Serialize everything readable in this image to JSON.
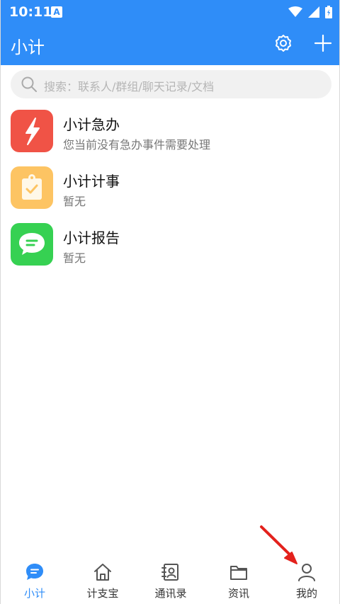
{
  "status_bar": {
    "time": "10:11",
    "a_badge": "A"
  },
  "header": {
    "title": "小计",
    "icons": [
      "gear-icon",
      "plus-icon"
    ]
  },
  "search": {
    "placeholder": "搜索：联系人/群组/聊天记录/文档"
  },
  "list": [
    {
      "title": "小计急办",
      "subtitle": "您当前没有急办事件需要处理",
      "icon": "lightning-icon",
      "color": "#f05346"
    },
    {
      "title": "小计计事",
      "subtitle": "暂无",
      "icon": "clipboard-icon",
      "color": "#fdc463"
    },
    {
      "title": "小计报告",
      "subtitle": "暂无",
      "icon": "chat-bubble-icon",
      "color": "#36d152"
    }
  ],
  "bottom_nav": [
    {
      "label": "小计",
      "icon": "chat-icon",
      "active": true
    },
    {
      "label": "计支宝",
      "icon": "home-icon",
      "active": false
    },
    {
      "label": "通讯录",
      "icon": "contacts-icon",
      "active": false
    },
    {
      "label": "资讯",
      "icon": "folder-icon",
      "active": false
    },
    {
      "label": "我的",
      "icon": "person-icon",
      "active": false
    }
  ],
  "colors": {
    "primary": "#2f8df8",
    "annotation_arrow": "#e3211c"
  }
}
